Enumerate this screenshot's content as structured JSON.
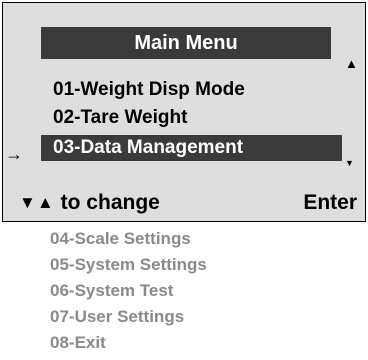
{
  "screen": {
    "title": "Main Menu",
    "scroll_up_icon": "triangle-up",
    "scroll_down_icon": "triangle-down",
    "cursor": "→",
    "visible_items": [
      {
        "label": "01-Weight Disp Mode"
      },
      {
        "label": "02-Tare Weight"
      },
      {
        "label": "03-Data Management",
        "selected": true
      }
    ],
    "footer": {
      "arrows": "▼▲",
      "change_label": "to change",
      "enter_label": "Enter"
    }
  },
  "offscreen_items": [
    {
      "label": "04-Scale Settings"
    },
    {
      "label": "05-System Settings"
    },
    {
      "label": "06-System Test"
    },
    {
      "label": "07-User Settings"
    },
    {
      "label": "08-Exit"
    }
  ],
  "colors": {
    "screen_bg": "#dedede",
    "highlight_bg": "#3a3a3a",
    "offscreen_text": "#8a8a8a"
  }
}
